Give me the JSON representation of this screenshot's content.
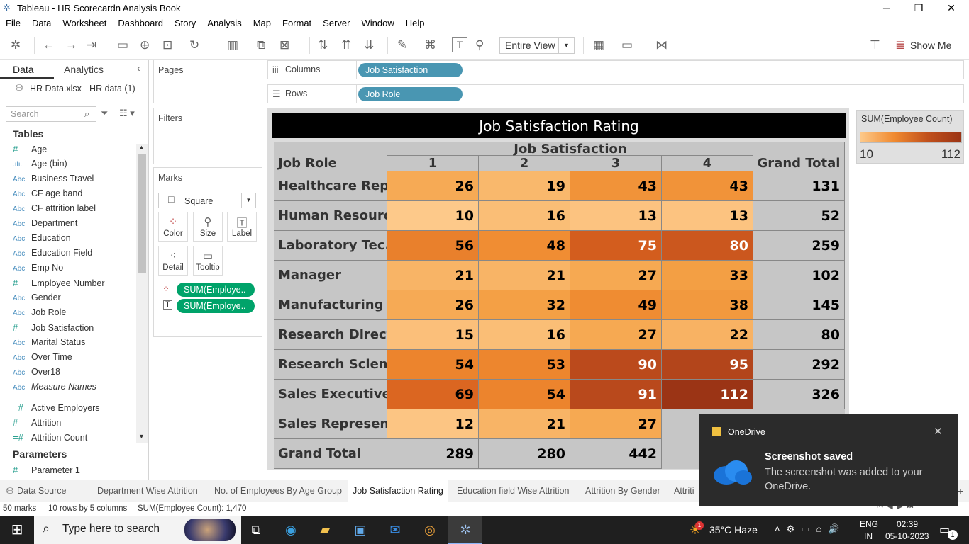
{
  "window": {
    "title": "Tableau - HR Scorecardn Analysis Book"
  },
  "menu": [
    "File",
    "Data",
    "Worksheet",
    "Dashboard",
    "Story",
    "Analysis",
    "Map",
    "Format",
    "Server",
    "Window",
    "Help"
  ],
  "toolbar": {
    "view_select": "Entire View",
    "show_me": "Show Me"
  },
  "leftpane": {
    "tab_data": "Data",
    "tab_analytics": "Analytics",
    "datasource": "HR Data.xlsx - HR data (1)",
    "search_placeholder": "Search",
    "tables_title": "Tables",
    "fields": [
      {
        "icon": "#",
        "name": "Age"
      },
      {
        "icon": ".ılı.",
        "name": "Age (bin)"
      },
      {
        "icon": "Abc",
        "name": "Business Travel"
      },
      {
        "icon": "Abc",
        "name": "CF age band"
      },
      {
        "icon": "Abc",
        "name": "CF attrition label"
      },
      {
        "icon": "Abc",
        "name": "Department"
      },
      {
        "icon": "Abc",
        "name": "Education"
      },
      {
        "icon": "Abc",
        "name": "Education Field"
      },
      {
        "icon": "Abc",
        "name": "Emp No"
      },
      {
        "icon": "#",
        "name": "Employee Number"
      },
      {
        "icon": "Abc",
        "name": "Gender"
      },
      {
        "icon": "Abc",
        "name": "Job Role"
      },
      {
        "icon": "#",
        "name": "Job Satisfaction"
      },
      {
        "icon": "Abc",
        "name": "Marital Status"
      },
      {
        "icon": "Abc",
        "name": "Over Time"
      },
      {
        "icon": "Abc",
        "name": "Over18"
      },
      {
        "icon": "Abc",
        "name": "Measure Names"
      }
    ],
    "measures": [
      {
        "icon": "=#",
        "name": "Active Employers"
      },
      {
        "icon": "#",
        "name": "Attrition"
      },
      {
        "icon": "=#",
        "name": "Attrition Count"
      }
    ],
    "parameters_title": "Parameters",
    "parameters": [
      {
        "icon": "#",
        "name": "Parameter 1"
      }
    ]
  },
  "shelves": {
    "pages": "Pages",
    "filters": "Filters",
    "marks": "Marks",
    "mark_type": "Square",
    "mark_buttons": [
      "Color",
      "Size",
      "Label",
      "Detail",
      "Tooltip"
    ],
    "mark_pills": [
      "SUM(Employe..",
      "SUM(Employe.."
    ],
    "columns_label": "Columns",
    "rows_label": "Rows",
    "columns_pill": "Job Satisfaction",
    "rows_pill": "Job Role"
  },
  "chart_data": {
    "type": "table",
    "title": "Job Satisfaction Rating",
    "column_header": "Job Satisfaction",
    "row_header": "Job Role",
    "columns": [
      "1",
      "2",
      "3",
      "4",
      "Grand Total"
    ],
    "rows": [
      {
        "label": "Healthcare Rep..",
        "values": [
          26,
          19,
          43,
          43
        ],
        "total": 131
      },
      {
        "label": "Human Resourc..",
        "values": [
          10,
          16,
          13,
          13
        ],
        "total": 52
      },
      {
        "label": "Laboratory Tec..",
        "values": [
          56,
          48,
          75,
          80
        ],
        "total": 259
      },
      {
        "label": "Manager",
        "values": [
          21,
          21,
          27,
          33
        ],
        "total": 102
      },
      {
        "label": "Manufacturing ..",
        "values": [
          26,
          32,
          49,
          38
        ],
        "total": 145
      },
      {
        "label": "Research Direct..",
        "values": [
          15,
          16,
          27,
          22
        ],
        "total": 80
      },
      {
        "label": "Research Scient..",
        "values": [
          54,
          53,
          90,
          95
        ],
        "total": 292
      },
      {
        "label": "Sales Executive",
        "values": [
          69,
          54,
          91,
          112
        ],
        "total": 326
      },
      {
        "label": "Sales Represen..",
        "values": [
          12,
          21,
          27,
          null
        ],
        "total": null
      }
    ],
    "grand_total": {
      "label": "Grand Total",
      "values": [
        289,
        280,
        442,
        null
      ]
    },
    "color_min": 10,
    "color_max": 112,
    "color_low": "#fdc98a",
    "color_high": "#9b3415"
  },
  "legend": {
    "title": "SUM(Employee Count)",
    "min": "10",
    "max": "112"
  },
  "tabs": [
    "Data Source",
    "Department Wise Attrition",
    "No. of Employees By Age Group",
    "Job Satisfaction Rating",
    "Education field Wise Attrition",
    "Attrition By Gender",
    "Attriti"
  ],
  "active_tab": "Job Satisfaction Rating",
  "status": {
    "marks": "50 marks",
    "rowscols": "10 rows by 5 columns",
    "sum": "SUM(Employee Count): 1,470"
  },
  "taskbar": {
    "search": "Type here to search",
    "weather": "35°C  Haze",
    "lang1": "ENG",
    "lang2": "IN",
    "time": "02:39",
    "date": "05-10-2023",
    "notif_count": "1",
    "weather_badge": "1"
  },
  "toast": {
    "app": "OneDrive",
    "title": "Screenshot saved",
    "body": "The screenshot was added to your OneDrive."
  }
}
